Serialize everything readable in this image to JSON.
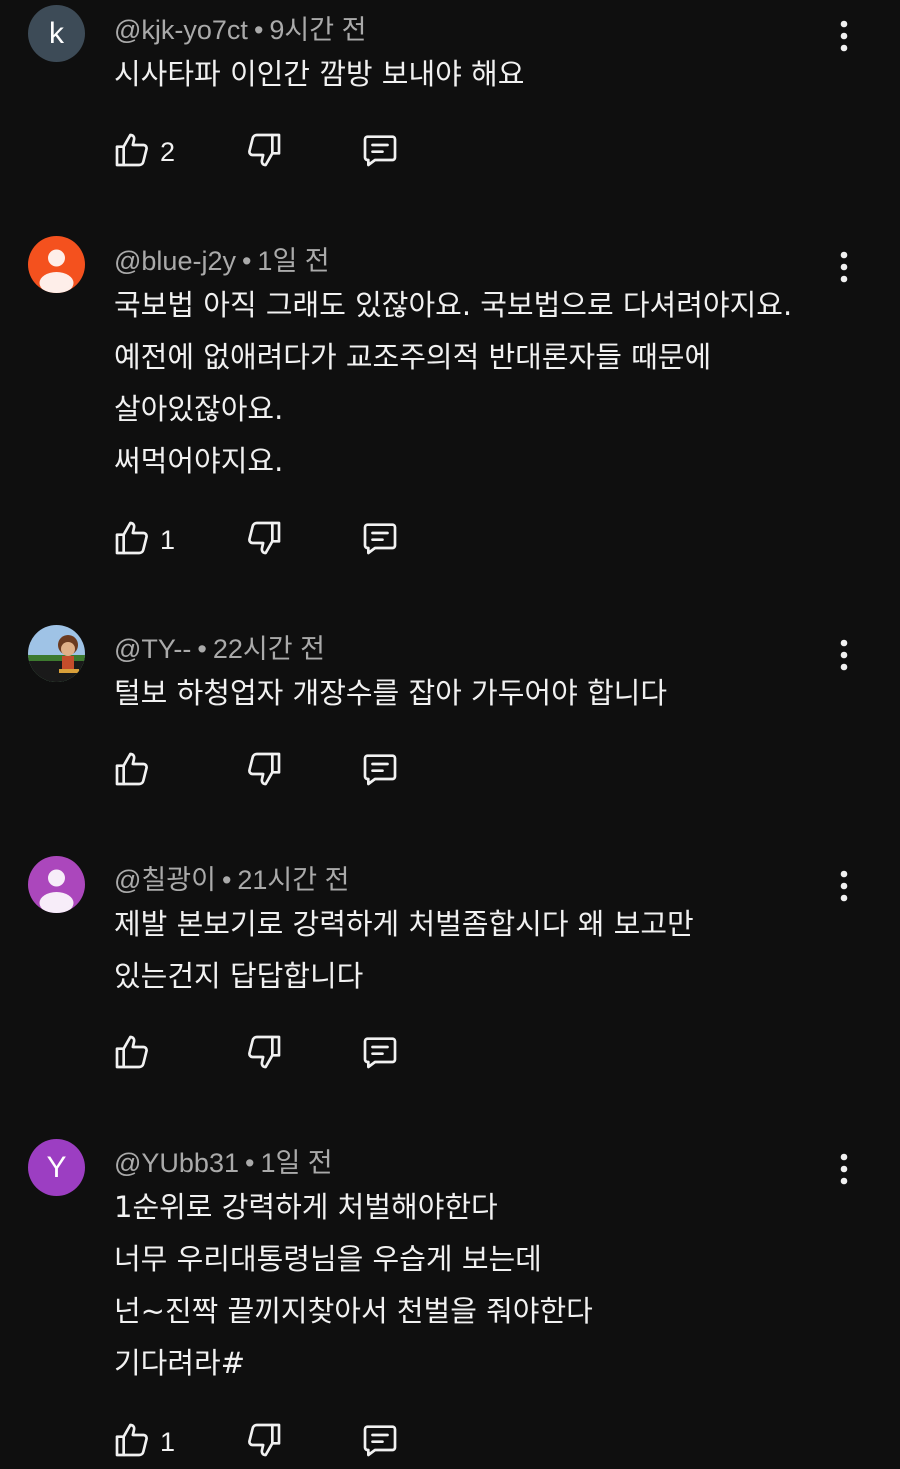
{
  "comments": [
    {
      "handle": "@kjk-yo7ct",
      "time": "9시간 전",
      "avatar_letter": "k",
      "avatar_color": "#3d4b57",
      "avatar_type": "letter",
      "lines": [
        "시사타파  이인간 깜방 보내야 해요"
      ],
      "likes": "2"
    },
    {
      "handle": "@blue-j2y",
      "time": "1일 전",
      "avatar_letter": "",
      "avatar_color": "#f4511e",
      "avatar_type": "person",
      "lines": [
        "국보법 아직 그래도 있잖아요. 국보법으로 다셔려야지요.",
        "예전에 없애려다가 교조주의적 반대론자들 때문에",
        "살아있잖아요.",
        "써먹어야지요."
      ],
      "likes": "1"
    },
    {
      "handle": "@TY--",
      "time": "22시간 전",
      "avatar_letter": "",
      "avatar_color": "#4a6fa5",
      "avatar_type": "photo",
      "lines": [
        "털보 하청업자 개장수를 잡아 가두어야 합니다"
      ],
      "likes": ""
    },
    {
      "handle": "@칠광이",
      "time": "21시간 전",
      "avatar_letter": "",
      "avatar_color": "#ab47bc",
      "avatar_type": "person",
      "lines": [
        "제발 본보기로 강력하게 처벌좀합시다 왜 보고만",
        "있는건지 답답합니다"
      ],
      "likes": ""
    },
    {
      "handle": "@YUbb31",
      "time": "1일 전",
      "avatar_letter": "Y",
      "avatar_color": "#9c3ec2",
      "avatar_type": "letter",
      "lines": [
        "1순위로  강력하게 처벌해야한다",
        "너무 우리대통령님을 우습게  보는데",
        "넌~진짝 끝끼지찾아서 천벌을 줘야한다",
        "기다려라#"
      ],
      "likes": "1"
    }
  ]
}
